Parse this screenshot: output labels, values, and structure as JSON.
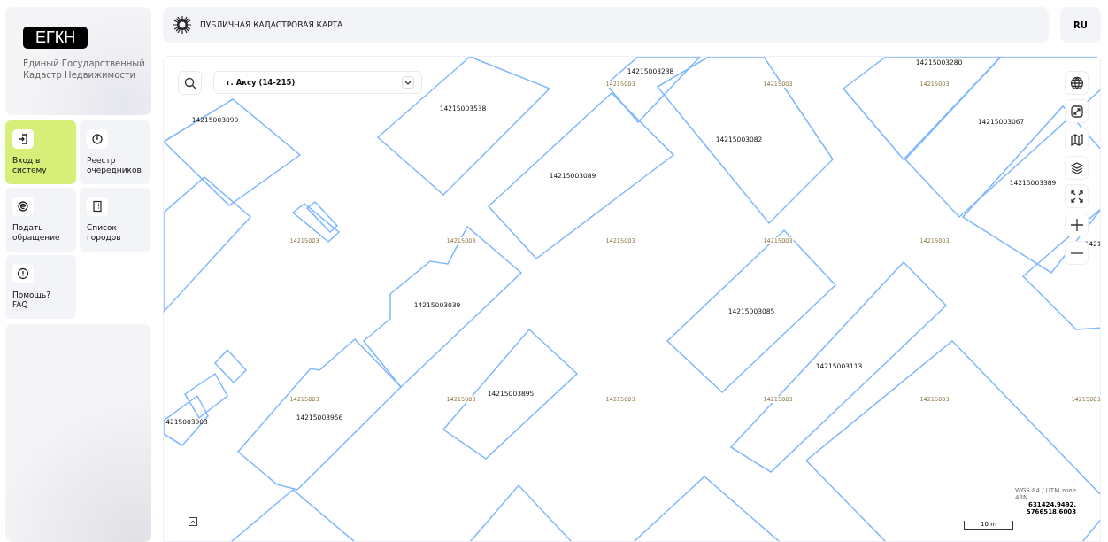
{
  "logo": {
    "abbr": "ЕГКН",
    "subtitle": "Единый Государственный\nКадастр Недвижимости"
  },
  "nav": [
    {
      "label": "Вход в\nсистему",
      "selected": true
    },
    {
      "label": "Реестр\nочередников",
      "selected": false
    },
    {
      "label": "Подать\nобращение",
      "selected": false
    },
    {
      "label": "Список\nгородов",
      "selected": false
    },
    {
      "label": "Помощь?\nFAQ",
      "selected": false
    }
  ],
  "header": {
    "title": "ПУБЛИЧНАЯ КАДАСТРОВАЯ КАРТА",
    "language": "RU"
  },
  "map": {
    "city_select": {
      "value": "г. Аксу (14-215)"
    },
    "parcels": [
      "14215003238",
      "14215003280",
      "14215003538",
      "14215003090",
      "14215003067",
      "14215003082",
      "14215003089",
      "14215003389",
      "14215003039",
      "14215003085",
      "14215003113",
      "14215003895",
      "14215003956",
      "4215003903",
      "1421"
    ],
    "block_labels": [
      "14215003",
      "14215003",
      "14215003",
      "14215003",
      "14215003",
      "14215003",
      "14215003",
      "14215003",
      "14215003",
      "14215003",
      "14215003",
      "14215003",
      "14215003",
      "14215003"
    ],
    "projection": "WGS 84 / UTM zone\n43N",
    "coordinates": "631424.9492,\n5766518.6003",
    "scale": "10 m"
  }
}
